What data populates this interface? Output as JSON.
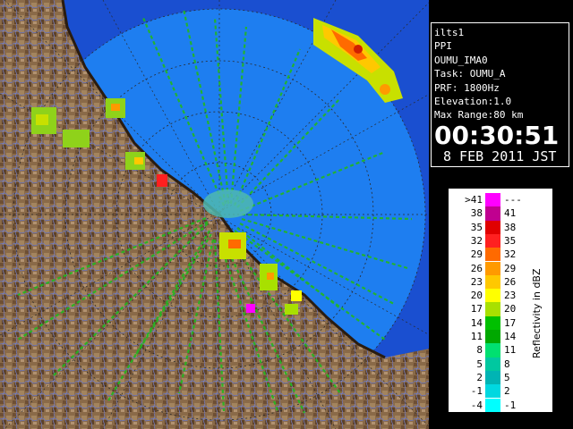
{
  "info": {
    "station": "ilts1",
    "scan_type": "PPI",
    "product": "OUMU_IMA0",
    "task": "Task: OUMU_A",
    "prf": "PRF: 1800Hz",
    "elevation": "Elevation:1.0",
    "max_range": "Max Range:80 km",
    "time": "00:30:51",
    "date": "8 FEB 2011 JST"
  },
  "legend": {
    "unit": "Reflectivity in dBZ",
    "rows": [
      {
        "low": ">41",
        "high": "---",
        "color": "#ff00ff"
      },
      {
        "low": "38",
        "high": "41",
        "color": "#c00090"
      },
      {
        "low": "35",
        "high": "38",
        "color": "#e00000"
      },
      {
        "low": "32",
        "high": "35",
        "color": "#ff2020"
      },
      {
        "low": "29",
        "high": "32",
        "color": "#ff6a00"
      },
      {
        "low": "26",
        "high": "29",
        "color": "#ff9a00"
      },
      {
        "low": "23",
        "high": "26",
        "color": "#ffc800"
      },
      {
        "low": "20",
        "high": "23",
        "color": "#ffff00"
      },
      {
        "low": "17",
        "high": "20",
        "color": "#a8e000"
      },
      {
        "low": "14",
        "high": "17",
        "color": "#00c000"
      },
      {
        "low": "11",
        "high": "14",
        "color": "#00a800"
      },
      {
        "low": "8",
        "high": "11",
        "color": "#00e070"
      },
      {
        "low": "5",
        "high": "8",
        "color": "#00c8a0"
      },
      {
        "low": "2",
        "high": "5",
        "color": "#00b4b4"
      },
      {
        "low": "-1",
        "high": "2",
        "color": "#00d8e0"
      },
      {
        "low": "-4",
        "high": "-1",
        "color": "#00ffff"
      }
    ]
  }
}
